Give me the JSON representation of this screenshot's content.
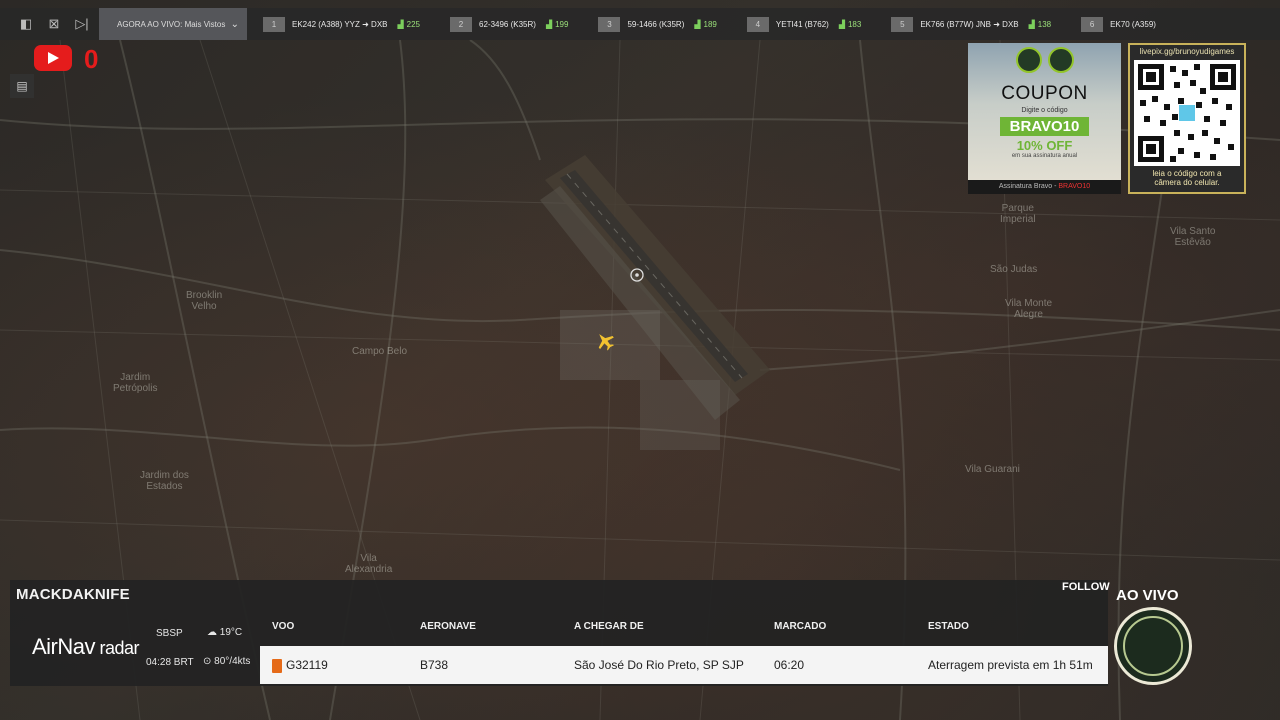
{
  "topbar": {
    "controls": [
      "sidebar-toggle-icon",
      "close-window-icon",
      "next-icon"
    ],
    "now_live_label": "AGORA AO VIVO: Mais Vistos",
    "flights": [
      {
        "num": "1",
        "label": "EK242 (A388)  YYZ ➜ DXB",
        "seats": "225"
      },
      {
        "num": "2",
        "label": "62-3496 (K35R)",
        "seats": "199"
      },
      {
        "num": "3",
        "label": "59-1466 (K35R)",
        "seats": "189"
      },
      {
        "num": "4",
        "label": "YETI41 (B762)",
        "seats": "183"
      },
      {
        "num": "5",
        "label": "EK766 (B77W)  JNB ➜ DXB",
        "seats": "138"
      },
      {
        "num": "6",
        "label": "EK70 (A359)",
        "seats": ""
      }
    ]
  },
  "youtube": {
    "count": "0"
  },
  "coupon": {
    "title": "COUPON",
    "subtitle": "Digite o código",
    "code": "BRAVO10",
    "discount": "10% OFF",
    "fine_print": "em sua assinatura anual",
    "url_prefix": "Assinatura Bravo - ",
    "url_highlight": "BRAVO10 radar.com/subscribe"
  },
  "qr": {
    "url": "livepix.gg/brunoyudigames",
    "caption_line1": "leia o código com a",
    "caption_line2": "câmera do celular."
  },
  "map": {
    "places": [
      {
        "text": "Brooklin\nVelho"
      },
      {
        "text": "Campo Belo"
      },
      {
        "text": "Jardim\nPetrópolis"
      },
      {
        "text": "Jardim dos\nEstados"
      },
      {
        "text": "São Judas"
      },
      {
        "text": "Vila Monte\nAlegre"
      },
      {
        "text": "Vila Guarani"
      },
      {
        "text": "Parque\nImperial"
      },
      {
        "text": "Vila Santo\nEstêvão"
      },
      {
        "text": "Vila\nAlexandria"
      }
    ]
  },
  "info": {
    "username": "MACKDAKNIFE",
    "follow": "FOLLOW",
    "brand_bold": "AirNav",
    "brand_thin": " radar",
    "icao": "SBSP",
    "time": "04:28 BRT",
    "temp": "19°C",
    "wind": "80°/4kts",
    "columns": {
      "flight": "VOO",
      "aircraft": "AERONAVE",
      "arriving_from": "A CHEGAR DE",
      "scheduled": "MARCADO",
      "status": "ESTADO"
    },
    "row": {
      "flight": "G32119",
      "aircraft": "B738",
      "origin": "São José Do Rio Preto, SP SJP",
      "scheduled": "06:20",
      "status": "Aterragem prevista em 1h 51m"
    }
  },
  "live": {
    "label": "AO VIVO"
  },
  "colors": {
    "accent_red": "#e51c1c",
    "seat_green": "#9be07a",
    "aircraft_yellow": "#f2c230",
    "coupon_green": "#6fb536"
  }
}
